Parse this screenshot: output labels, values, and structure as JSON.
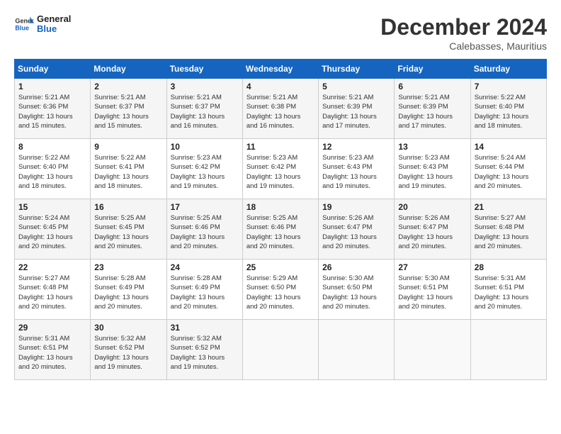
{
  "header": {
    "logo_line1": "General",
    "logo_line2": "Blue",
    "month_title": "December 2024",
    "location": "Calebasses, Mauritius"
  },
  "days_of_week": [
    "Sunday",
    "Monday",
    "Tuesday",
    "Wednesday",
    "Thursday",
    "Friday",
    "Saturday"
  ],
  "weeks": [
    [
      {
        "day": "1",
        "info": "Sunrise: 5:21 AM\nSunset: 6:36 PM\nDaylight: 13 hours\nand 15 minutes."
      },
      {
        "day": "2",
        "info": "Sunrise: 5:21 AM\nSunset: 6:37 PM\nDaylight: 13 hours\nand 15 minutes."
      },
      {
        "day": "3",
        "info": "Sunrise: 5:21 AM\nSunset: 6:37 PM\nDaylight: 13 hours\nand 16 minutes."
      },
      {
        "day": "4",
        "info": "Sunrise: 5:21 AM\nSunset: 6:38 PM\nDaylight: 13 hours\nand 16 minutes."
      },
      {
        "day": "5",
        "info": "Sunrise: 5:21 AM\nSunset: 6:39 PM\nDaylight: 13 hours\nand 17 minutes."
      },
      {
        "day": "6",
        "info": "Sunrise: 5:21 AM\nSunset: 6:39 PM\nDaylight: 13 hours\nand 17 minutes."
      },
      {
        "day": "7",
        "info": "Sunrise: 5:22 AM\nSunset: 6:40 PM\nDaylight: 13 hours\nand 18 minutes."
      }
    ],
    [
      {
        "day": "8",
        "info": "Sunrise: 5:22 AM\nSunset: 6:40 PM\nDaylight: 13 hours\nand 18 minutes."
      },
      {
        "day": "9",
        "info": "Sunrise: 5:22 AM\nSunset: 6:41 PM\nDaylight: 13 hours\nand 18 minutes."
      },
      {
        "day": "10",
        "info": "Sunrise: 5:23 AM\nSunset: 6:42 PM\nDaylight: 13 hours\nand 19 minutes."
      },
      {
        "day": "11",
        "info": "Sunrise: 5:23 AM\nSunset: 6:42 PM\nDaylight: 13 hours\nand 19 minutes."
      },
      {
        "day": "12",
        "info": "Sunrise: 5:23 AM\nSunset: 6:43 PM\nDaylight: 13 hours\nand 19 minutes."
      },
      {
        "day": "13",
        "info": "Sunrise: 5:23 AM\nSunset: 6:43 PM\nDaylight: 13 hours\nand 19 minutes."
      },
      {
        "day": "14",
        "info": "Sunrise: 5:24 AM\nSunset: 6:44 PM\nDaylight: 13 hours\nand 20 minutes."
      }
    ],
    [
      {
        "day": "15",
        "info": "Sunrise: 5:24 AM\nSunset: 6:45 PM\nDaylight: 13 hours\nand 20 minutes."
      },
      {
        "day": "16",
        "info": "Sunrise: 5:25 AM\nSunset: 6:45 PM\nDaylight: 13 hours\nand 20 minutes."
      },
      {
        "day": "17",
        "info": "Sunrise: 5:25 AM\nSunset: 6:46 PM\nDaylight: 13 hours\nand 20 minutes."
      },
      {
        "day": "18",
        "info": "Sunrise: 5:25 AM\nSunset: 6:46 PM\nDaylight: 13 hours\nand 20 minutes."
      },
      {
        "day": "19",
        "info": "Sunrise: 5:26 AM\nSunset: 6:47 PM\nDaylight: 13 hours\nand 20 minutes."
      },
      {
        "day": "20",
        "info": "Sunrise: 5:26 AM\nSunset: 6:47 PM\nDaylight: 13 hours\nand 20 minutes."
      },
      {
        "day": "21",
        "info": "Sunrise: 5:27 AM\nSunset: 6:48 PM\nDaylight: 13 hours\nand 20 minutes."
      }
    ],
    [
      {
        "day": "22",
        "info": "Sunrise: 5:27 AM\nSunset: 6:48 PM\nDaylight: 13 hours\nand 20 minutes."
      },
      {
        "day": "23",
        "info": "Sunrise: 5:28 AM\nSunset: 6:49 PM\nDaylight: 13 hours\nand 20 minutes."
      },
      {
        "day": "24",
        "info": "Sunrise: 5:28 AM\nSunset: 6:49 PM\nDaylight: 13 hours\nand 20 minutes."
      },
      {
        "day": "25",
        "info": "Sunrise: 5:29 AM\nSunset: 6:50 PM\nDaylight: 13 hours\nand 20 minutes."
      },
      {
        "day": "26",
        "info": "Sunrise: 5:30 AM\nSunset: 6:50 PM\nDaylight: 13 hours\nand 20 minutes."
      },
      {
        "day": "27",
        "info": "Sunrise: 5:30 AM\nSunset: 6:51 PM\nDaylight: 13 hours\nand 20 minutes."
      },
      {
        "day": "28",
        "info": "Sunrise: 5:31 AM\nSunset: 6:51 PM\nDaylight: 13 hours\nand 20 minutes."
      }
    ],
    [
      {
        "day": "29",
        "info": "Sunrise: 5:31 AM\nSunset: 6:51 PM\nDaylight: 13 hours\nand 20 minutes."
      },
      {
        "day": "30",
        "info": "Sunrise: 5:32 AM\nSunset: 6:52 PM\nDaylight: 13 hours\nand 19 minutes."
      },
      {
        "day": "31",
        "info": "Sunrise: 5:32 AM\nSunset: 6:52 PM\nDaylight: 13 hours\nand 19 minutes."
      },
      {
        "day": "",
        "info": ""
      },
      {
        "day": "",
        "info": ""
      },
      {
        "day": "",
        "info": ""
      },
      {
        "day": "",
        "info": ""
      }
    ]
  ]
}
